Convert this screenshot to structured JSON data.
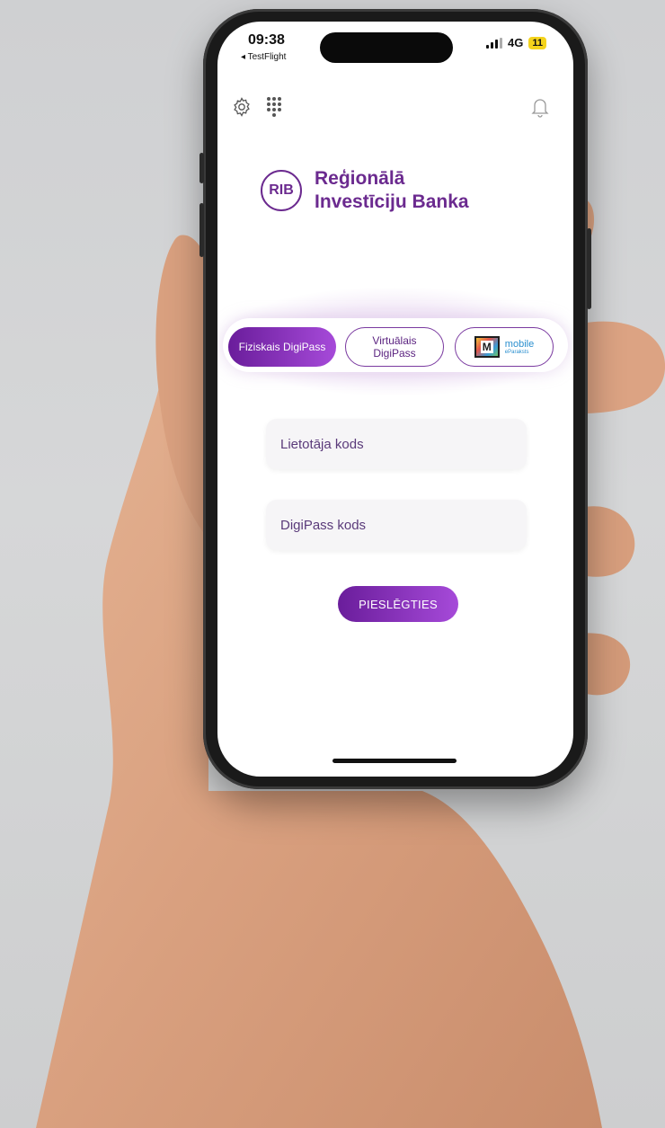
{
  "status_bar": {
    "time": "09:38",
    "back_app": "◂ TestFlight",
    "network": "4G",
    "battery": "11"
  },
  "toolbar": {
    "settings_icon": "gear-icon",
    "keypad_icon": "keypad-icon",
    "notifications_icon": "bell-icon"
  },
  "brand": {
    "logo_short": "RIB",
    "name_line1": "Reģionālā",
    "name_line2": "Investīciju Banka",
    "accent_color": "#6b2a8f"
  },
  "auth_tabs": {
    "items": [
      {
        "label": "Fiziskais DigiPass",
        "active": true
      },
      {
        "label_line1": "Virtuālais",
        "label_line2": "DigiPass",
        "active": false
      },
      {
        "logo_letter": "M",
        "label_line1": "mobile",
        "label_line2": "eParaksts",
        "active": false
      }
    ]
  },
  "form": {
    "user_code_placeholder": "Lietotāja kods",
    "digipass_code_placeholder": "DigiPass kods",
    "submit_label": "PIESLĒGTIES"
  }
}
